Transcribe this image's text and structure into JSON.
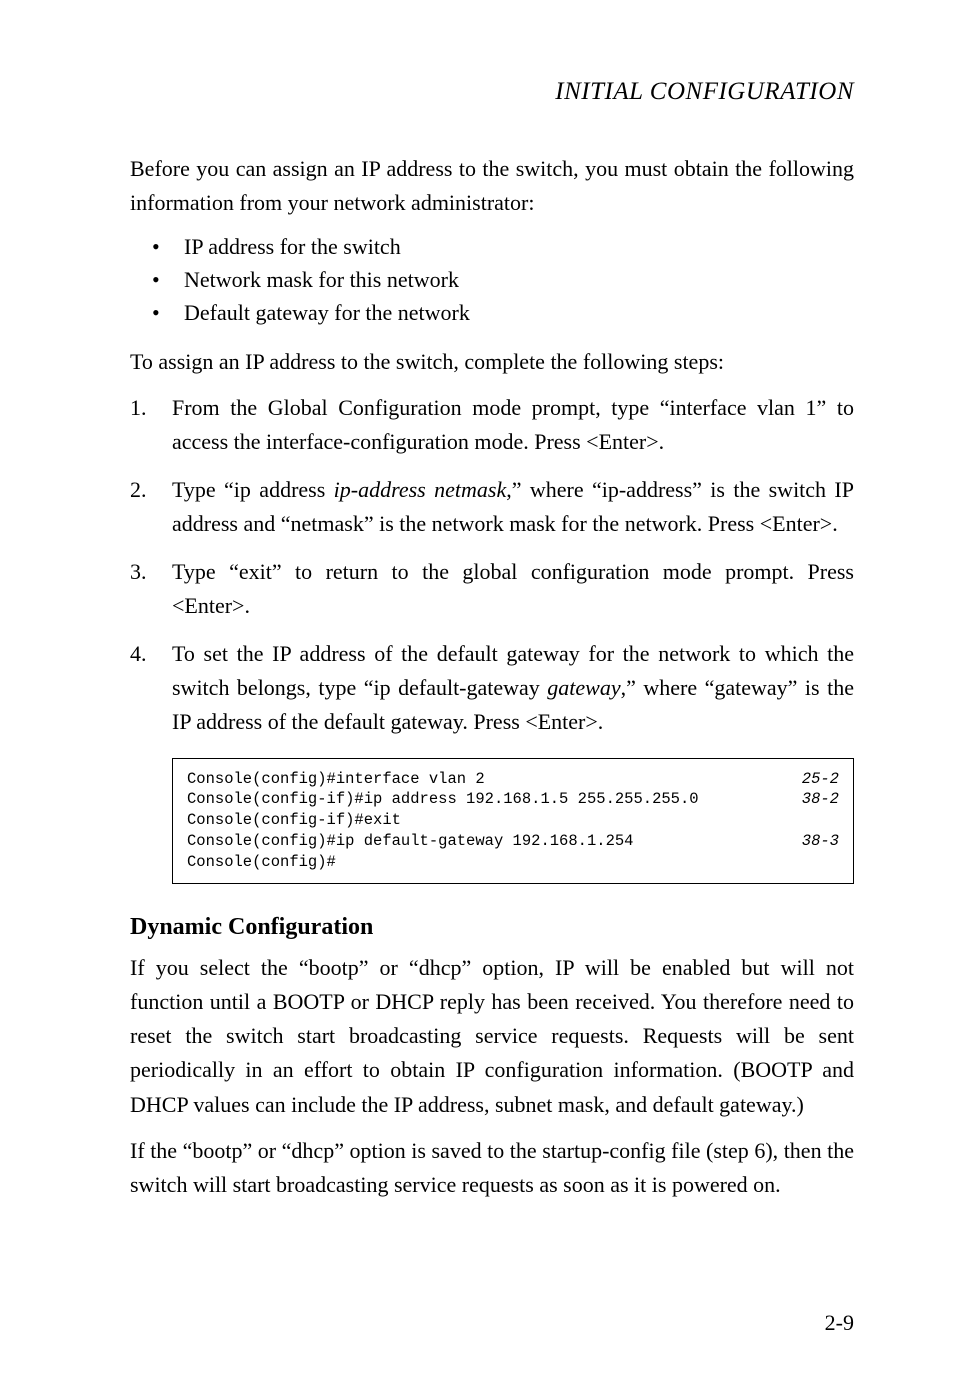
{
  "chapterTitle": "INITIAL CONFIGURATION",
  "intro": "Before you can assign an IP address to the switch, you must obtain the following information from your network administrator:",
  "bullets": [
    "IP address for the switch",
    "Network mask for this network",
    "Default gateway for the network"
  ],
  "lead": "To assign an IP address to the switch, complete the following steps:",
  "steps": [
    {
      "pre": "From the Global Configuration mode prompt, type “interface vlan 1” to access the interface-configuration mode. Press <Enter>."
    },
    {
      "pre": "Type “ip address ",
      "italic": "ip-address netmask",
      "post": ",” where “ip-address” is the switch IP address and “netmask” is the network mask for the network. Press <Enter>."
    },
    {
      "pre": "Type “exit” to return to the global configuration mode prompt. Press <Enter>."
    },
    {
      "pre": "To set the IP address of the default gateway for the network to which the switch belongs, type “ip default-gateway ",
      "italic": "gateway",
      "post": ",” where “gateway” is the IP address of the default gateway. Press <Enter>."
    }
  ],
  "code": [
    {
      "text": "Console(config)#interface vlan 2",
      "ref": "25-2"
    },
    {
      "text": "Console(config-if)#ip address 192.168.1.5 255.255.255.0",
      "ref": "38-2"
    },
    {
      "text": "Console(config-if)#exit",
      "ref": ""
    },
    {
      "text": "Console(config)#ip default-gateway 192.168.1.254",
      "ref": "38-3"
    },
    {
      "text": "Console(config)#",
      "ref": ""
    }
  ],
  "sectionTitle": "Dynamic Configuration",
  "para1": "If you select the “bootp” or “dhcp” option, IP will be enabled but will not function until a BOOTP or DHCP reply has been received. You therefore need to reset the switch start broadcasting service requests. Requests will be sent periodically in an effort to obtain IP configuration information. (BOOTP and DHCP values can include the IP address, subnet mask, and default gateway.)",
  "para2": "If the “bootp” or “dhcp” option is saved to the startup-config file (step 6), then the switch will start broadcasting service requests as soon as it is powered on.",
  "pageNum": "2-9"
}
